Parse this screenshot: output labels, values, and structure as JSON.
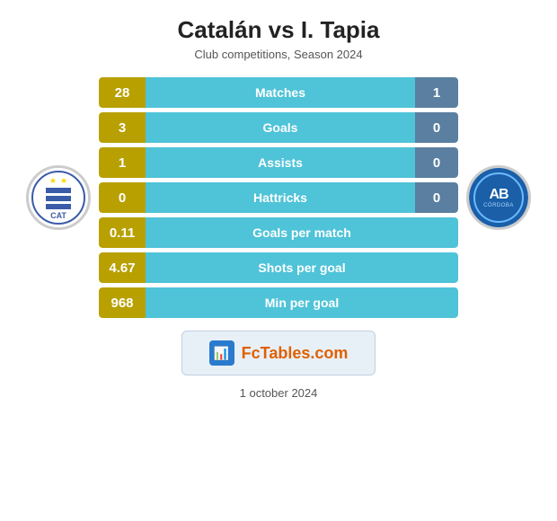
{
  "header": {
    "title": "Catalán vs I. Tapia",
    "subtitle": "Club competitions, Season 2024"
  },
  "stats": [
    {
      "id": "matches",
      "left": "28",
      "label": "Matches",
      "right": "1",
      "type": "two-val"
    },
    {
      "id": "goals",
      "left": "3",
      "label": "Goals",
      "right": "0",
      "type": "two-val"
    },
    {
      "id": "assists",
      "left": "1",
      "label": "Assists",
      "right": "0",
      "type": "two-val"
    },
    {
      "id": "hattricks",
      "left": "0",
      "label": "Hattricks",
      "right": "0",
      "type": "two-val"
    },
    {
      "id": "goals-per-match",
      "left": "0.11",
      "label": "Goals per match",
      "right": null,
      "type": "one-val"
    },
    {
      "id": "shots-per-goal",
      "left": "4.67",
      "label": "Shots per goal",
      "right": null,
      "type": "one-val"
    },
    {
      "id": "min-per-goal",
      "left": "968",
      "label": "Min per goal",
      "right": null,
      "type": "one-val"
    }
  ],
  "fctables": {
    "icon": "📊",
    "brand_prefix": "Fc",
    "brand_suffix": "Tables.com"
  },
  "footer": {
    "date": "1 october 2024"
  },
  "left_team": {
    "name": "CAT",
    "stars": [
      "★",
      "★"
    ]
  },
  "right_team": {
    "initials": "AB",
    "sub": "CÓRDOBA"
  }
}
